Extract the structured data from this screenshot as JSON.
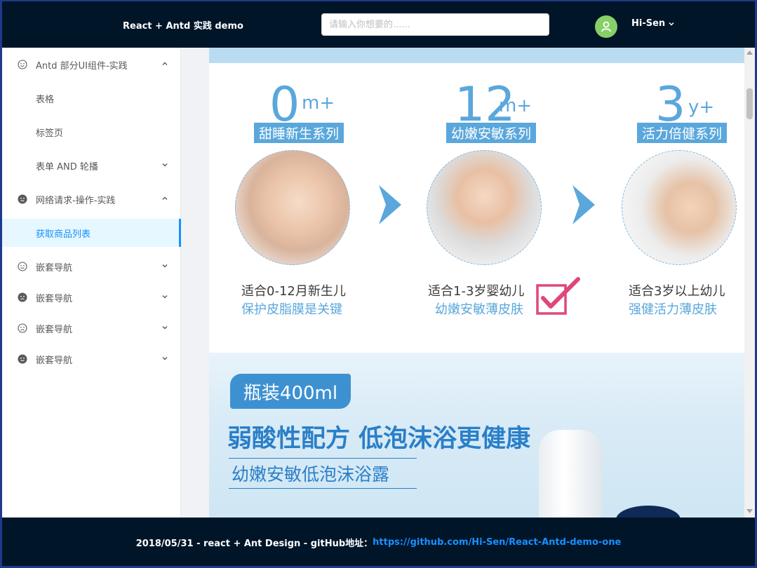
{
  "header": {
    "brand": "React + Antd 实践 demo",
    "search_placeholder": "请输入你想要的......",
    "user_name": "Hi-Sen"
  },
  "sidebar": {
    "items": [
      {
        "label": "Antd 部分UI组件-实践",
        "icon": "smile-icon",
        "expanded": true
      },
      {
        "label": "表格"
      },
      {
        "label": "标签页"
      },
      {
        "label": "表单 AND 轮播",
        "expanded": false
      },
      {
        "label": "网络请求-操作-实践",
        "icon": "frown-filled-icon",
        "expanded": true
      },
      {
        "label": "获取商品列表",
        "active": true
      },
      {
        "label": "嵌套导航",
        "icon": "smile-icon"
      },
      {
        "label": "嵌套导航",
        "icon": "frown-filled-icon"
      },
      {
        "label": "嵌套导航",
        "icon": "frown-icon"
      },
      {
        "label": "嵌套导航",
        "icon": "smile-filled-icon"
      }
    ]
  },
  "banner": {
    "stages": [
      {
        "num": "0",
        "suffix": "m+",
        "series": "甜睡新生系列",
        "line1": "适合0-12月新生儿",
        "line2": "保护皮脂膜是关键"
      },
      {
        "num": "12",
        "suffix": "m+",
        "series": "幼嫩安敏系列",
        "line1": "适合1-3岁婴幼儿",
        "line2": "幼嫩安敏薄皮肤"
      },
      {
        "num": "3",
        "suffix": "y+",
        "series": "活力倍健系列",
        "line1": "适合3岁以上幼儿",
        "line2": "强健活力薄皮肤"
      }
    ]
  },
  "product": {
    "tag": "瓶装400ml",
    "headline": "弱酸性配方 低泡沫浴更健康",
    "subline": "幼嫩安敏低泡沫浴露"
  },
  "footer": {
    "text": "2018/05/31 - react + Ant Design - gitHub地址：",
    "link": "https://github.com/Hi-Sen/React-Antd-demo-one"
  },
  "colors": {
    "header_bg": "#011529",
    "accent": "#1890ff",
    "banner_blue": "#5aa7dc",
    "avatar_green": "#87d068"
  }
}
